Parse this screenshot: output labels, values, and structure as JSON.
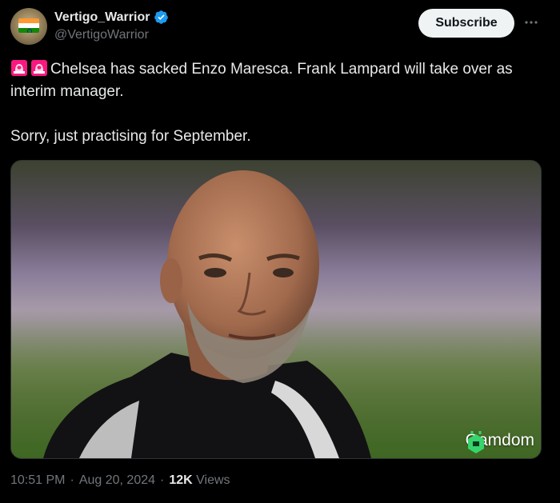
{
  "author": {
    "name": "Vertigo_Warrior",
    "handle": "@VertigoWarrior",
    "avatar_icon": "india-flag-avatar",
    "verified": true
  },
  "actions": {
    "subscribe_label": "Subscribe",
    "more_icon": "more-horizontal-icon"
  },
  "tweet": {
    "line1": "Chelsea has sacked Enzo Maresca. Frank Lampard will take over as interim manager.",
    "line2": "Sorry, just practising for September.",
    "emoji_icons": [
      "rotating-light-icon",
      "rotating-light-icon"
    ]
  },
  "media": {
    "watermark": "Gamdom"
  },
  "meta": {
    "time": "10:51 PM",
    "separator": "·",
    "date": "Aug 20, 2024",
    "views_count": "12K",
    "views_label": "Views"
  },
  "colors": {
    "background": "#000000",
    "text": "#e7e9ea",
    "secondary": "#71767b",
    "verified": "#1d9bf0",
    "siren": "#f91880"
  }
}
